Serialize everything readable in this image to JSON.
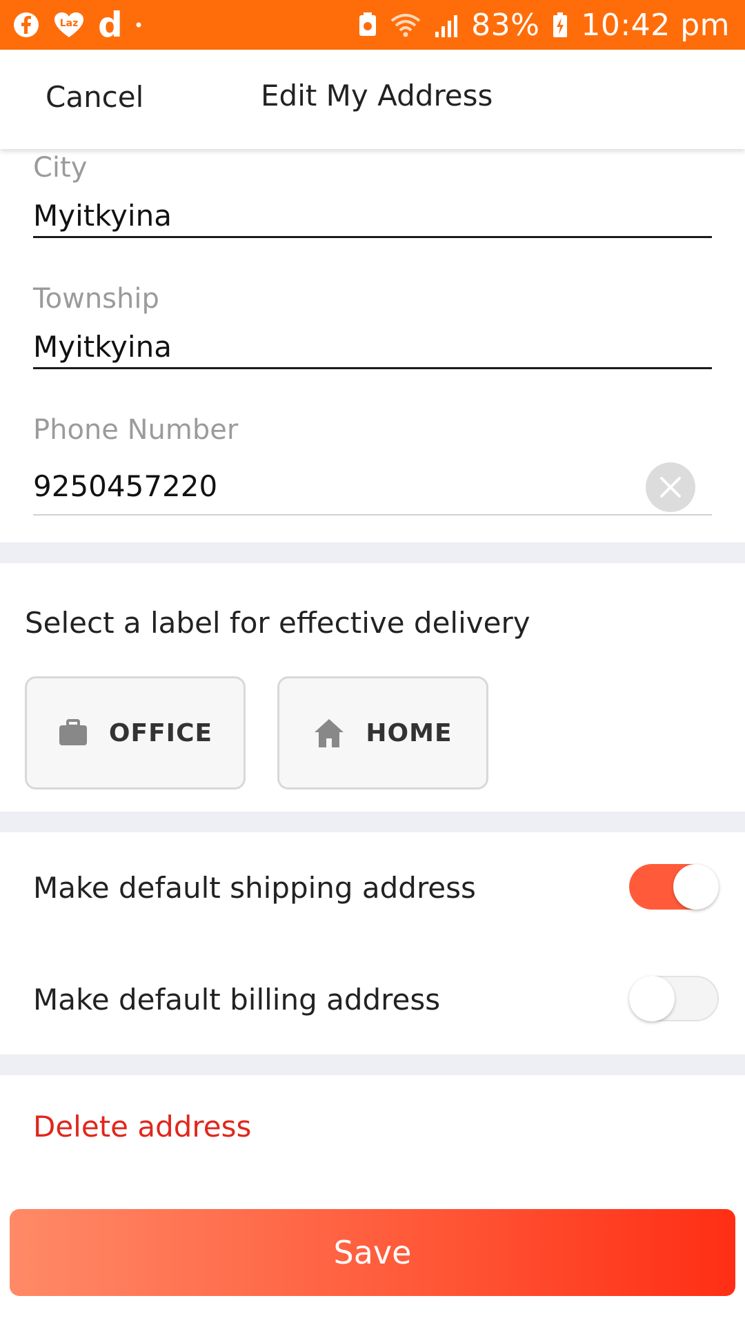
{
  "status_bar": {
    "battery": "83%",
    "time": "10:42 pm",
    "left_icons": [
      "facebook-icon",
      "lazada-icon",
      "d-icon",
      "dot-icon"
    ],
    "d_glyph": "d",
    "right_icons": [
      "nfc-icon",
      "wifi-icon",
      "signal-icon",
      "battery-charging-icon"
    ],
    "background": "#ff6d0a"
  },
  "header": {
    "cancel_label": "Cancel",
    "title": "Edit My Address"
  },
  "form": {
    "city": {
      "label": "City",
      "value": "Myitkyina"
    },
    "township": {
      "label": "Township",
      "value": "Myitkyina"
    },
    "phone": {
      "label": "Phone Number",
      "value": "9250457220"
    }
  },
  "delivery_label": {
    "title": "Select a label for effective delivery",
    "options": [
      {
        "label": "OFFICE",
        "icon": "briefcase-icon"
      },
      {
        "label": "HOME",
        "icon": "home-icon"
      }
    ]
  },
  "defaults": {
    "shipping": {
      "label": "Make default shipping address",
      "on": true
    },
    "billing": {
      "label": "Make default billing address",
      "on": false
    }
  },
  "delete_label": "Delete address",
  "save_label": "Save",
  "colors": {
    "accent": "#ff5b3a",
    "danger": "#e1261c",
    "muted": "#9b9b9b"
  }
}
